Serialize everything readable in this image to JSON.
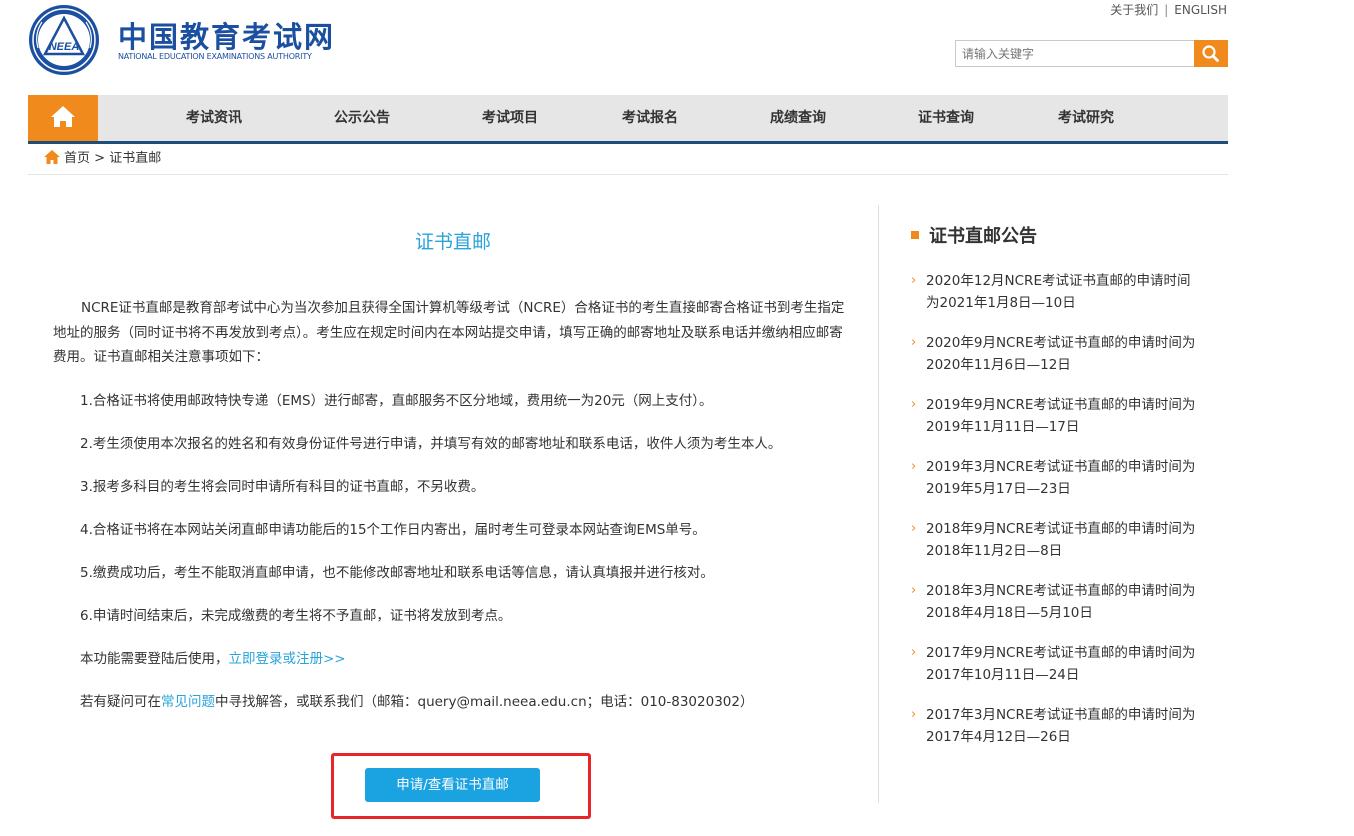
{
  "header": {
    "logo_cn": "中国教育考试网",
    "logo_en": "NATIONAL EDUCATION EXAMINATIONS AUTHORITY",
    "logo_emblem_text": "NEEA",
    "top_links": [
      "关于我们",
      "ENGLISH"
    ],
    "search_placeholder": "请输入关键字",
    "search_icon": "search-icon"
  },
  "nav": {
    "home_icon": "home-icon",
    "items": [
      "考试资讯",
      "公示公告",
      "考试项目",
      "考试报名",
      "成绩查询",
      "证书查询",
      "考试研究"
    ]
  },
  "breadcrumb": {
    "home": "首页",
    "separator": ">",
    "current": "证书直邮"
  },
  "main": {
    "title": "证书直邮",
    "intro": "NCRE证书直邮是教育部考试中心为当次参加且获得全国计算机等级考试（NCRE）合格证书的考生直接邮寄合格证书到考生指定地址的服务（同时证书将不再发放到考点）。考生应在规定时间内在本网站提交申请，填写正确的邮寄地址及联系电话并缴纳相应邮寄费用。证书直邮相关注意事项如下：",
    "items": [
      "1.合格证书将使用邮政特快专递（EMS）进行邮寄，直邮服务不区分地域，费用统一为20元（网上支付）。",
      "2.考生须使用本次报名的姓名和有效身份证件号进行申请，并填写有效的邮寄地址和联系电话，收件人须为考生本人。",
      "3.报考多科目的考生将会同时申请所有科目的证书直邮，不另收费。",
      "4.合格证书将在本网站关闭直邮申请功能后的15个工作日内寄出，届时考生可登录本网站查询EMS单号。",
      "5.缴费成功后，考生不能取消直邮申请，也不能修改邮寄地址和联系电话等信息，请认真填报并进行核对。",
      "6.申请时间结束后，未完成缴费的考生将不予直邮，证书将发放到考点。"
    ],
    "login_prefix": "本功能需要登陆后使用，",
    "login_link": "立即登录或注册>>",
    "faq_prefix": "若有疑问可在",
    "faq_link": "常见问题",
    "faq_suffix": "中寻找解答，或联系我们（邮箱：query@mail.neea.edu.cn；电话：010-83020302）",
    "apply_button": "申请/查看证书直邮"
  },
  "sidebar": {
    "title": "证书直邮公告",
    "news": [
      [
        "2020年12月NCRE考试证书直邮的申请时间",
        "为2021年1月8日—10日"
      ],
      [
        "2020年9月NCRE考试证书直邮的申请时间为",
        "2020年11月6日—12日"
      ],
      [
        "2019年9月NCRE考试证书直邮的申请时间为",
        "2019年11月11日—17日"
      ],
      [
        "2019年3月NCRE考试证书直邮的申请时间为",
        "2019年5月17日—23日"
      ],
      [
        "2018年9月NCRE考试证书直邮的申请时间为",
        "2018年11月2日—8日"
      ],
      [
        "2018年3月NCRE考试证书直邮的申请时间为",
        "2018年4月18日—5月10日"
      ],
      [
        "2017年9月NCRE考试证书直邮的申请时间为",
        "2017年10月11日—24日"
      ],
      [
        "2017年3月NCRE考试证书直邮的申请时间为",
        "2017年4月12日—26日"
      ]
    ]
  },
  "colors": {
    "brand_blue": "#1b4fa0",
    "accent_orange": "#f08a1c",
    "link_blue": "#2aa3d8",
    "button_blue": "#1aa3e0",
    "highlight_red": "#e8262a"
  }
}
